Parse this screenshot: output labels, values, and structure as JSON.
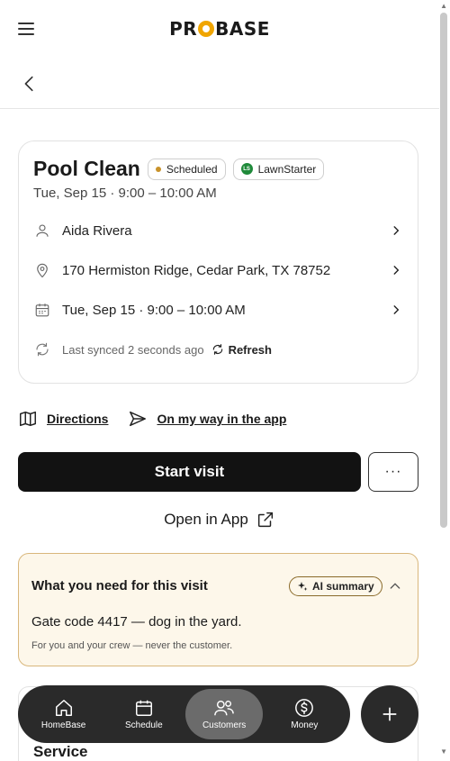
{
  "header": {
    "logo_text": "PROBASE",
    "logo_accent": "#f0a500"
  },
  "job": {
    "title": "Pool Clean",
    "status_badge": "Scheduled",
    "status_color": "#c9922a",
    "source_badge": "LawnStarter",
    "source_logo": "LS",
    "subtitle": "Tue, Sep 15 · 9:00 – 10:00 AM"
  },
  "details": {
    "customer": "Aida Rivera",
    "address": "170 Hermiston Ridge, Cedar Park, TX 78752",
    "datetime": "Tue, Sep 15 · 9:00 – 10:00 AM",
    "sync_text": "Last synced 2 seconds ago",
    "refresh_label": "Refresh"
  },
  "actions": {
    "directions": "Directions",
    "on_my_way": "On my way in the app",
    "start_visit": "Start visit",
    "more": "···",
    "open_in_app": "Open in App"
  },
  "needs": {
    "title": "What you need for this visit",
    "ai_badge": "AI summary",
    "text": "Gate code 4417 — dog in the yard.",
    "note": "For you and your crew — never the customer."
  },
  "service": {
    "title": "Service"
  },
  "bottom_nav": {
    "items": [
      {
        "label": "HomeBase",
        "icon": "home-icon"
      },
      {
        "label": "Schedule",
        "icon": "calendar-icon"
      },
      {
        "label": "Customers",
        "icon": "users-icon",
        "active": true
      },
      {
        "label": "Money",
        "icon": "dollar-icon"
      }
    ],
    "fab_icon": "plus-icon"
  }
}
